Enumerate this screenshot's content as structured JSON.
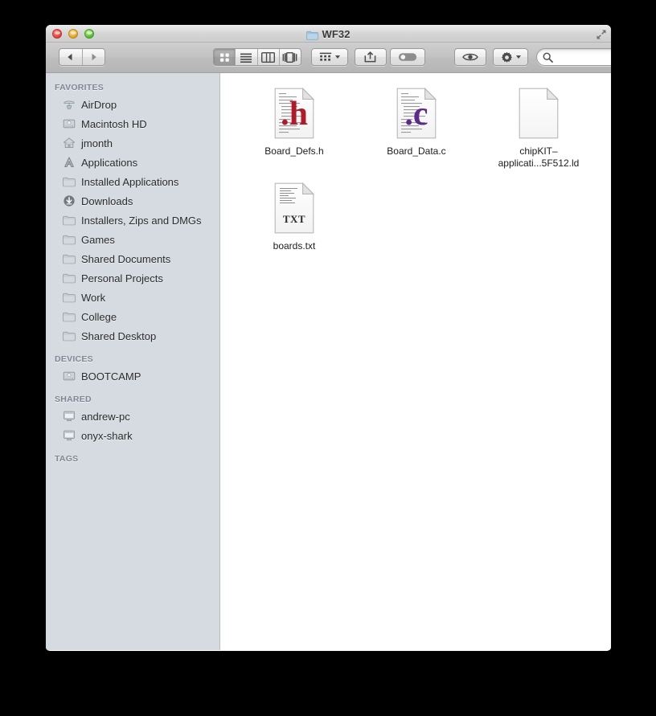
{
  "window": {
    "title": "WF32",
    "title_icon": "folder-icon",
    "controls": {
      "close": "close-button",
      "minimize": "minimize-button",
      "zoom": "zoom-button",
      "fullscreen": "fullscreen-button"
    }
  },
  "toolbar": {
    "back_label": "back-button",
    "forward_label": "forward-button",
    "view_modes": [
      {
        "name": "icon-view",
        "label": "Icon View",
        "selected": true
      },
      {
        "name": "list-view",
        "label": "List View",
        "selected": false
      },
      {
        "name": "column-view",
        "label": "Column View",
        "selected": false
      },
      {
        "name": "coverflow-view",
        "label": "Cover Flow View",
        "selected": false
      }
    ],
    "arrange_label": "Arrange",
    "share_label": "Share",
    "tag_label": "Tags",
    "quicklook_label": "Quick Look",
    "action_label": "Action"
  },
  "search": {
    "value": "",
    "placeholder": ""
  },
  "sidebar": {
    "sections": [
      {
        "header": "FAVORITES",
        "items": [
          {
            "label": "AirDrop",
            "icon": "airdrop-icon"
          },
          {
            "label": "Macintosh HD",
            "icon": "harddisk-icon"
          },
          {
            "label": "jmonth",
            "icon": "home-icon"
          },
          {
            "label": "Applications",
            "icon": "applications-icon"
          },
          {
            "label": "Installed Applications",
            "icon": "folder-icon"
          },
          {
            "label": "Downloads",
            "icon": "downloads-icon"
          },
          {
            "label": "Installers, Zips and DMGs",
            "icon": "folder-icon"
          },
          {
            "label": "Games",
            "icon": "folder-icon"
          },
          {
            "label": "Shared Documents",
            "icon": "folder-icon"
          },
          {
            "label": "Personal Projects",
            "icon": "folder-icon"
          },
          {
            "label": "Work",
            "icon": "folder-icon"
          },
          {
            "label": "College",
            "icon": "folder-icon"
          },
          {
            "label": "Shared Desktop",
            "icon": "folder-icon"
          }
        ]
      },
      {
        "header": "DEVICES",
        "items": [
          {
            "label": "BOOTCAMP",
            "icon": "harddisk-icon"
          }
        ]
      },
      {
        "header": "SHARED",
        "items": [
          {
            "label": "andrew-pc",
            "icon": "computer-icon"
          },
          {
            "label": "onyx-shark",
            "icon": "computer-icon"
          }
        ]
      },
      {
        "header": "TAGS",
        "items": []
      }
    ]
  },
  "content": {
    "files": [
      {
        "name": "Board_Defs.h",
        "icon": "source-file-h-icon",
        "badge": ".h",
        "badge_color": "#b21a2a",
        "lines": true
      },
      {
        "name": "Board_Data.c",
        "icon": "source-file-c-icon",
        "badge": ".c",
        "badge_color": "#5b2a8c",
        "lines": true
      },
      {
        "name_line1": "chipKIT–",
        "name_line2": "applicati...5F512.ld",
        "name": "chipKIT–applicati...5F512.ld",
        "icon": "blank-document-icon",
        "badge": "",
        "badge_color": "",
        "lines": false
      },
      {
        "name": "boards.txt",
        "icon": "text-file-icon",
        "badge": "TXT",
        "badge_color": "#2b2b2b",
        "lines": true
      }
    ]
  },
  "colors": {
    "sidebar_bg": "#d5dbe1",
    "sidebar_header_text": "#7e8794",
    "content_bg": "#ffffff",
    "desktop_bg": "#000000",
    "titlebar_text": "#3a3a3a"
  }
}
